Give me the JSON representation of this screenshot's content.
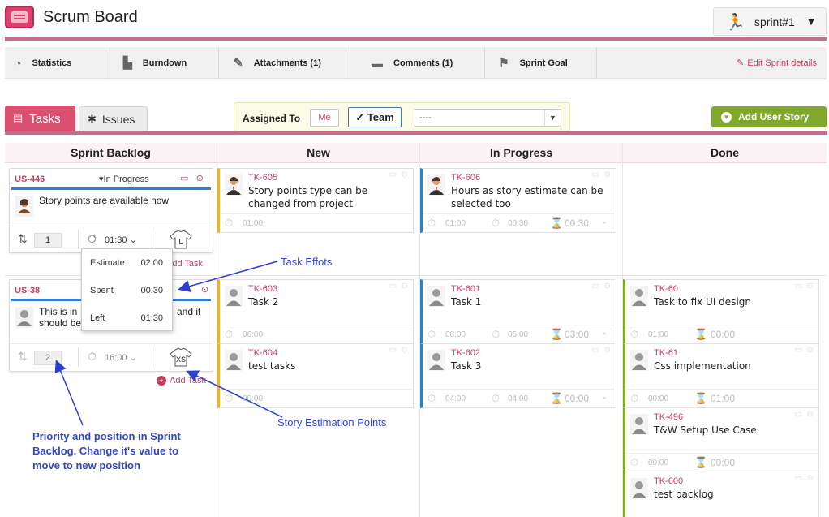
{
  "header": {
    "title": "Scrum Board",
    "sprint": "sprint#1"
  },
  "toolbar": {
    "items": [
      "Statistics",
      "Burndown",
      "Attachments (1)",
      "Comments (1)",
      "Sprint Goal"
    ],
    "edit_label": "Edit Sprint details"
  },
  "tabs": {
    "tasks": "Tasks",
    "issues": "Issues"
  },
  "assign": {
    "label": "Assigned To",
    "me": "Me",
    "team": "Team",
    "member_value": "----"
  },
  "add_story": "Add User Story",
  "columns": [
    "Sprint Backlog",
    "New",
    "In Progress",
    "Done"
  ],
  "stories": [
    {
      "id": "US-446",
      "status": "In Progress",
      "text": "Story points are available now",
      "priority": "1",
      "time": "01:30",
      "size": "L",
      "add_task": "Add Task"
    },
    {
      "id": "US-38",
      "text": "This is in... and it should be...",
      "text_left": "This is in",
      "text_left2": "should be",
      "text_right": "and it",
      "priority": "2",
      "time": "16:00",
      "size": "XS",
      "add_task": "Add Task"
    }
  ],
  "popup": {
    "rows": [
      {
        "label": "Estimate",
        "value": "02:00"
      },
      {
        "label": "Spent",
        "value": "00:30"
      },
      {
        "label": "Left",
        "value": "01:30"
      }
    ]
  },
  "tasks": {
    "new": [
      {
        "id": "TK-605",
        "title": "Story points type can be changed from project",
        "est": "01:00",
        "spent": "",
        "left": ""
      },
      {
        "id": "TK-603",
        "title": "Task 2",
        "est": "06:00",
        "spent": "",
        "left": ""
      },
      {
        "id": "TK-604",
        "title": "test tasks",
        "est": "00:00",
        "spent": "",
        "left": ""
      }
    ],
    "in_progress": [
      {
        "id": "TK-606",
        "title": "Hours as story estimate can be selected too",
        "est": "01:00",
        "spent": "00:30",
        "left": "00:30"
      },
      {
        "id": "TK-601",
        "title": "Task 1",
        "est": "08:00",
        "spent": "05:00",
        "left": "03:00"
      },
      {
        "id": "TK-602",
        "title": "Task 3",
        "est": "04:00",
        "spent": "04:00",
        "left": "00:00"
      }
    ],
    "done": [
      {
        "id": "TK-60",
        "title": "Task to fix UI design",
        "est": "01:00",
        "spent": "",
        "left": "00:00"
      },
      {
        "id": "TK-61",
        "title": "Css implementation",
        "est": "00:00",
        "spent": "",
        "left": "01:00"
      },
      {
        "id": "TK-496",
        "title": "T&W Setup Use Case",
        "est": "00:00",
        "spent": "",
        "left": "00:00"
      },
      {
        "id": "TK-600",
        "title": "test backlog",
        "est": "",
        "spent": "",
        "left": ""
      }
    ]
  },
  "annotations": {
    "task_efforts": "Task Effots",
    "story_points": "Story Estimation Points",
    "priority_line1": "Priority and position in Sprint",
    "priority_line2": "Backlog. Change it's value to",
    "priority_line3": "move to new position"
  },
  "colors": {
    "accent": "#c96b8c",
    "tab": "#d9516f",
    "add_story": "#80a82a",
    "story_id": "#c0405f",
    "annotation": "#3346c8"
  }
}
